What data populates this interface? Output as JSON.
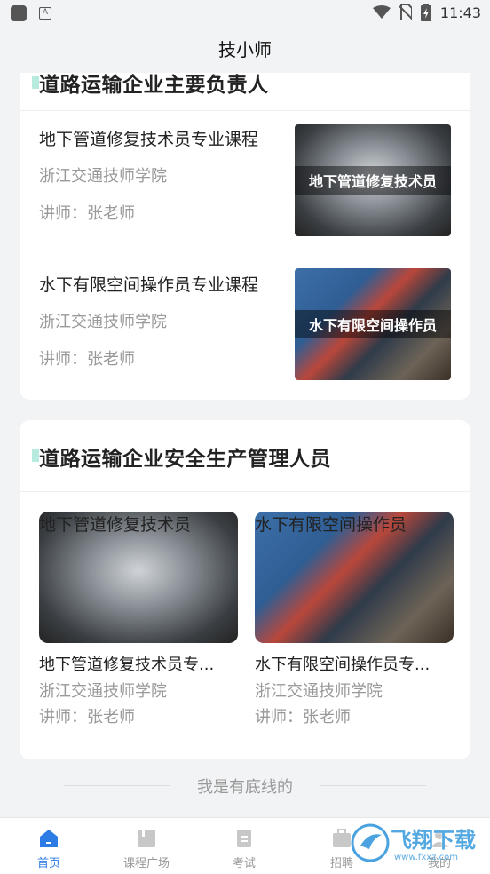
{
  "status_bar": {
    "time": "11:43"
  },
  "header": {
    "title": "技小师"
  },
  "section1": {
    "title": "道路运输企业主要负责人",
    "items": [
      {
        "title": "地下管道修复技术员专业课程",
        "school": "浙江交通技师学院",
        "teacher": "讲师：张老师",
        "thumb_caption": "地下管道修复技术员"
      },
      {
        "title": "水下有限空间操作员专业课程",
        "school": "浙江交通技师学院",
        "teacher": "讲师：张老师",
        "thumb_caption": "水下有限空间操作员"
      }
    ]
  },
  "section2": {
    "title": "道路运输企业安全生产管理人员",
    "items": [
      {
        "title": "地下管道修复技术员专...",
        "school": "浙江交通技师学院",
        "teacher": "讲师：张老师",
        "thumb_caption": "地下管道修复技术员"
      },
      {
        "title": "水下有限空间操作员专...",
        "school": "浙江交通技师学院",
        "teacher": "讲师：张老师",
        "thumb_caption": "水下有限空间操作员"
      }
    ]
  },
  "footer_note": "我是有底线的",
  "tabs": [
    {
      "label": "首页",
      "icon": "home-icon",
      "active": true
    },
    {
      "label": "课程广场",
      "icon": "book-icon",
      "active": false
    },
    {
      "label": "考试",
      "icon": "document-icon",
      "active": false
    },
    {
      "label": "招聘",
      "icon": "briefcase-icon",
      "active": false
    },
    {
      "label": "我的",
      "icon": "user-icon",
      "active": false
    }
  ],
  "watermark": {
    "text": "飞翔下载",
    "url_text": "www.fxxz.com"
  },
  "colors": {
    "accent": "#2d7be5",
    "section_bar": "#b8ebe0",
    "background": "#f2f3f5"
  }
}
